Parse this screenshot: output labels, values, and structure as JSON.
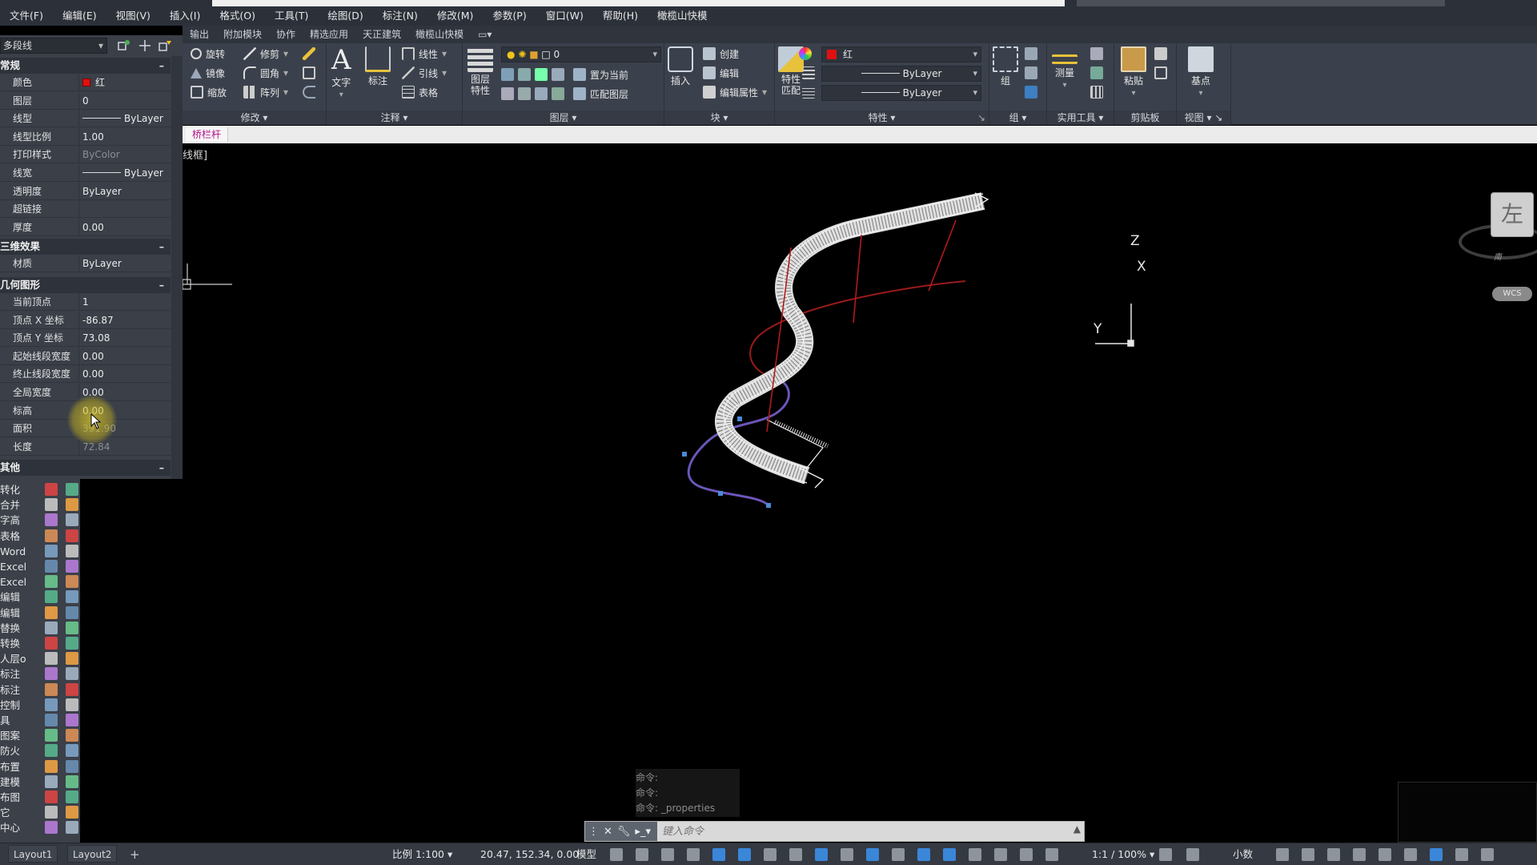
{
  "menu": [
    "文件(F)",
    "编辑(E)",
    "视图(V)",
    "插入(I)",
    "格式(O)",
    "工具(T)",
    "绘图(D)",
    "标注(N)",
    "修改(M)",
    "参数(P)",
    "窗口(W)",
    "帮助(H)",
    "橄榄山快模"
  ],
  "ribbon_tabs": [
    "输出",
    "附加模块",
    "协作",
    "精选应用",
    "天正建筑",
    "橄榄山快模"
  ],
  "ribbon": {
    "modify": {
      "title": "修改",
      "rotate": "旋转",
      "trim": "修剪",
      "mirror": "镜像",
      "fillet": "圆角",
      "scale": "缩放",
      "array": "阵列"
    },
    "annotation": {
      "title": "注释",
      "text": "文字",
      "dimension": "标注",
      "linear": "线性",
      "leader": "引线",
      "table": "表格"
    },
    "layers": {
      "title": "图层",
      "layer_props": "图层\n特性",
      "current_layer": "0",
      "set_current": "置为当前",
      "match_layer": "匹配图层"
    },
    "block": {
      "title": "块",
      "insert": "插入",
      "create": "创建",
      "edit": "编辑",
      "edit_attr": "编辑属性"
    },
    "properties": {
      "title": "特性",
      "match": "特性\n匹配",
      "color": "红",
      "linetype": "ByLayer",
      "lineweight": "ByLayer"
    },
    "group": {
      "title": "组",
      "group": "组"
    },
    "utilities": {
      "title": "实用工具",
      "measure": "测量"
    },
    "clipboard": {
      "title": "剪贴板",
      "paste": "粘贴"
    },
    "view": {
      "title": "视图",
      "base": "基点"
    }
  },
  "file_tab": "桥栏杆",
  "viewport_label": "线框]",
  "properties_palette": {
    "object_type": "多段线",
    "sections": {
      "general": {
        "title": "常规",
        "rows": [
          {
            "label": "颜色",
            "value": "红",
            "swatch": "#e01010"
          },
          {
            "label": "图层",
            "value": "0"
          },
          {
            "label": "线型",
            "value": "ByLayer",
            "line": true
          },
          {
            "label": "线型比例",
            "value": "1.00"
          },
          {
            "label": "打印样式",
            "value": "ByColor",
            "dim": true
          },
          {
            "label": "线宽",
            "value": "ByLayer",
            "line": true
          },
          {
            "label": "透明度",
            "value": "ByLayer"
          },
          {
            "label": "超链接",
            "value": ""
          },
          {
            "label": "厚度",
            "value": "0.00"
          }
        ]
      },
      "effects3d": {
        "title": "三维效果",
        "rows": [
          {
            "label": "材质",
            "value": "ByLayer"
          }
        ]
      },
      "geometry": {
        "title": "几何图形",
        "rows": [
          {
            "label": "当前顶点",
            "value": "1"
          },
          {
            "label": "顶点 X 坐标",
            "value": "-86.87"
          },
          {
            "label": "顶点 Y 坐标",
            "value": "73.08"
          },
          {
            "label": "起始线段宽度",
            "value": "0.00"
          },
          {
            "label": "终止线段宽度",
            "value": "0.00"
          },
          {
            "label": "全局宽度",
            "value": "0.00"
          },
          {
            "label": "标高",
            "value": "0.00"
          },
          {
            "label": "面积",
            "value": "391.90",
            "dim": true
          },
          {
            "label": "长度",
            "value": "72.84",
            "dim": true
          }
        ]
      },
      "misc": {
        "title": "其他"
      }
    }
  },
  "tool_labels": [
    "转化",
    "合并",
    "字高",
    "表格",
    "Word",
    "Excel",
    "Excel",
    "编辑",
    "编辑",
    "替换",
    "转换",
    "人层o",
    "标注",
    "标注",
    "控制",
    "具",
    "图案",
    "防火",
    "布置",
    "建模",
    "布图",
    "它",
    "中心"
  ],
  "viewcube": {
    "face": "左",
    "direction": "南",
    "wcs": "WCS"
  },
  "ucs_axes": {
    "x": "X",
    "y": "Y",
    "z": "Z"
  },
  "command_history": [
    "命令:",
    "命令:",
    "命令: _properties"
  ],
  "command_placeholder": "键入命令",
  "statusbar": {
    "layouts": [
      "Layout1",
      "Layout2"
    ],
    "add_layout": "+",
    "scale": "比例 1:100",
    "coords": "20.47, 152.34, 0.00",
    "model": "模型",
    "annotation_scale": "1:1 / 100%",
    "units": "小数"
  },
  "colors": {
    "accent_red": "#e01010",
    "file_tab_text": "#b0138a",
    "panel_bg": "#3a3f48",
    "ribbon_bg": "#3b414c"
  }
}
